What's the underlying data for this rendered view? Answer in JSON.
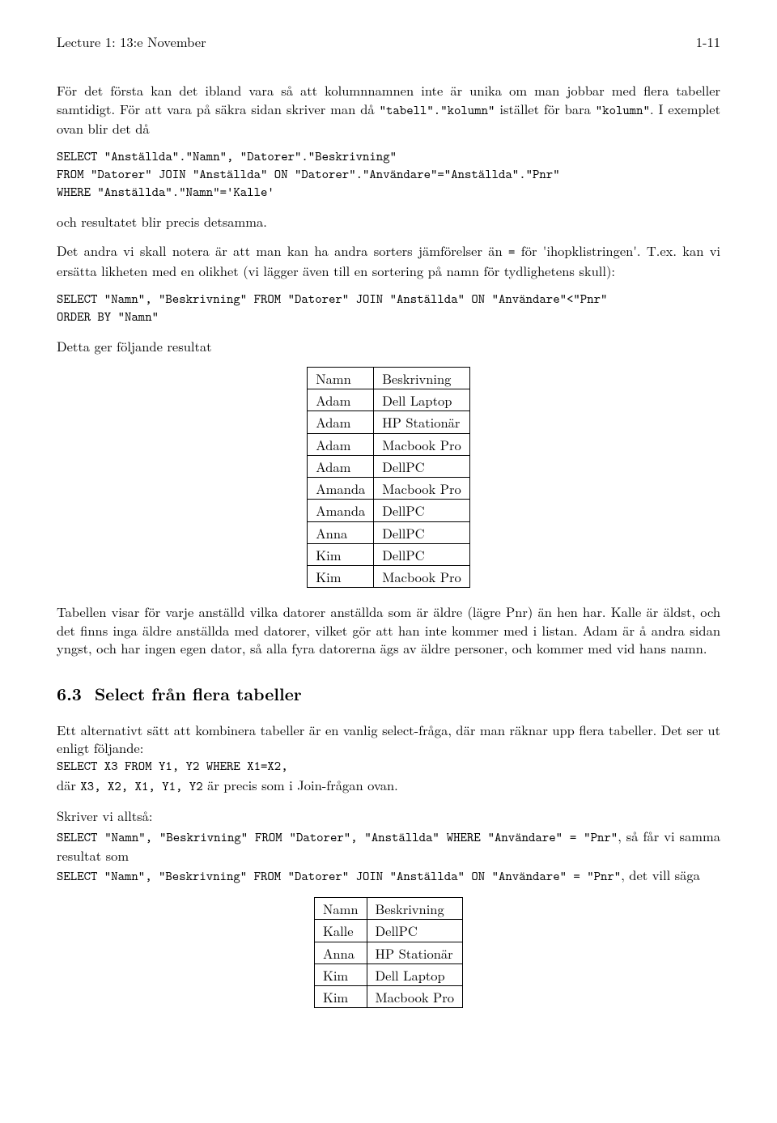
{
  "header": {
    "left": "Lecture 1: 13:e November",
    "right": "1-11"
  },
  "p1a": "För det första kan det ibland vara så att kolumnnamnen inte är unika om man jobbar med flera tabeller samtidigt. För att vara på säkra sidan skriver man då ",
  "p1c1": "\"tabell\".\"kolumn\"",
  "p1b": " istället för bara ",
  "p1c2": "\"kolumn\"",
  "p1c": ". I exemplet ovan blir det då",
  "code1": "SELECT \"Anställda\".\"Namn\", \"Datorer\".\"Beskrivning\"\nFROM \"Datorer\" JOIN \"Anställda\" ON \"Datorer\".\"Användare\"=\"Anställda\".\"Pnr\"\nWHERE \"Anställda\".\"Namn\"='Kalle'",
  "p2": "och resultatet blir precis detsamma.",
  "p3a": "Det andra vi skall notera är att man kan ha andra sorters jämförelser än ",
  "p3c1": "=",
  "p3b": " för 'ihopklistringen'. T.ex. kan vi ersätta likheten med en olikhet (vi lägger även till en sortering på namn för tydlighetens skull):",
  "code2": "SELECT \"Namn\", \"Beskrivning\" FROM \"Datorer\" JOIN \"Anställda\" ON \"Användare\"<\"Pnr\"\nORDER BY \"Namn\"",
  "p4": "Detta ger följande resultat",
  "table1": {
    "headers": [
      "Namn",
      "Beskrivning"
    ],
    "rows": [
      [
        "Adam",
        "Dell Laptop"
      ],
      [
        "Adam",
        "HP Stationär"
      ],
      [
        "Adam",
        "Macbook Pro"
      ],
      [
        "Adam",
        "DellPC"
      ],
      [
        "Amanda",
        "Macbook Pro"
      ],
      [
        "Amanda",
        "DellPC"
      ],
      [
        "Anna",
        "DellPC"
      ],
      [
        "Kim",
        "DellPC"
      ],
      [
        "Kim",
        "Macbook Pro"
      ]
    ]
  },
  "p5": "Tabellen visar för varje anställd vilka datorer anställda som är äldre (lägre Pnr) än hen har. Kalle är äldst, och det finns inga äldre anställda med datorer, vilket gör att han inte kommer med i listan. Adam är å andra sidan yngst, och har ingen egen dator, så alla fyra datorerna ägs av äldre personer, och kommer med vid hans namn.",
  "section": {
    "num": "6.3",
    "title": "Select från flera tabeller"
  },
  "p6": "Ett alternativt sätt att kombinera tabeller är en vanlig select-fråga, där man räknar upp flera tabeller. Det ser ut enligt följande:",
  "code3": "SELECT X3 FROM Y1, Y2 WHERE X1=X2,",
  "p7a": "där ",
  "p7c1": "X3, X2, X1, Y1, Y2",
  "p7b": " är precis som i Join-frågan ovan.",
  "p8": "Skriver vi alltså:",
  "code4": "SELECT \"Namn\", \"Beskrivning\" FROM \"Datorer\", \"Anställda\" WHERE \"Användare\" = \"Pnr\"",
  "p8tail": ", så får vi samma resultat som",
  "code5": "SELECT \"Namn\", \"Beskrivning\" FROM \"Datorer\" JOIN \"Anställda\" ON \"Användare\" = \"Pnr\"",
  "p8tail2": ", det vill säga",
  "table2": {
    "headers": [
      "Namn",
      "Beskrivning"
    ],
    "rows": [
      [
        "Kalle",
        "DellPC"
      ],
      [
        "Anna",
        "HP Stationär"
      ],
      [
        "Kim",
        "Dell Laptop"
      ],
      [
        "Kim",
        "Macbook Pro"
      ]
    ]
  }
}
